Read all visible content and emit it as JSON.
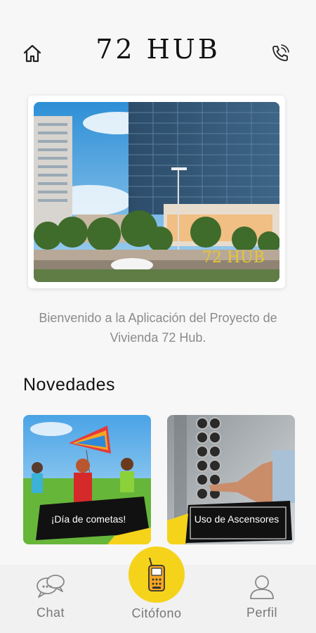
{
  "header": {
    "logo_text": "72 HUB",
    "home_icon": "home-icon",
    "phone_icon": "phone-call-icon"
  },
  "hero": {
    "watermark": "72 HUB"
  },
  "welcome_text": "Bienvenido a la Aplicación del Proyecto de Vivienda 72 Hub.",
  "news": {
    "title": "Novedades",
    "items": [
      {
        "label": "¡Día de cometas!"
      },
      {
        "label": "Uso de Ascensores"
      }
    ]
  },
  "nav": {
    "chat_label": "Chat",
    "citofono_label": "Citófono",
    "perfil_label": "Perfil"
  },
  "colors": {
    "accent": "#f5d31b",
    "background": "#f7f7f7",
    "label_gray": "#777777"
  }
}
